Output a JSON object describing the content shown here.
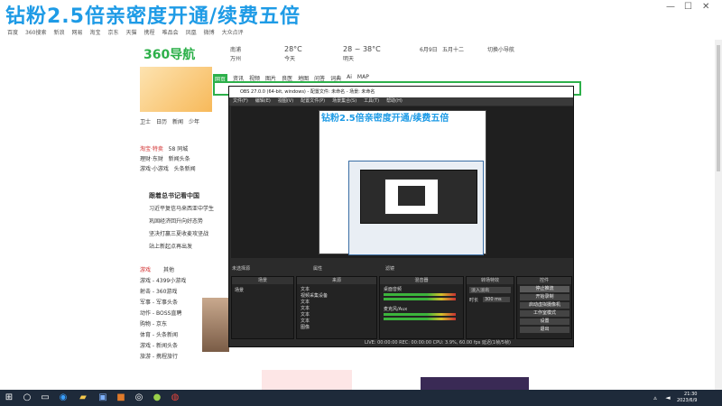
{
  "overlay_text": "钻粉2.5倍亲密度开通/续费五倍",
  "bookmarks": [
    "百度",
    "360搜索",
    "新浪",
    "网易",
    "淘宝",
    "京东",
    "天猫",
    "携程",
    "唯品会",
    "凤凰",
    "微博",
    "大众点评"
  ],
  "logo": "360导航",
  "weather": {
    "city1": "南浦",
    "loc1": "万州",
    "temp1": "28°C",
    "cond1": "今天",
    "temp2": "28 ~ 38°C",
    "cond2": "明天",
    "date": "6月9日",
    "lunar": "五月十二",
    "extra": "切换小导航"
  },
  "search_tabs": [
    "网页",
    "资讯",
    "视频",
    "图片",
    "良医",
    "地图",
    "问答",
    "词典",
    "Ai",
    "MAP"
  ],
  "left_nav": [
    "卫士",
    "日历",
    "新闻",
    "少年"
  ],
  "left_list": [
    "淘宝·特卖",
    "理财·东财",
    "游戏·小游戏"
  ],
  "left_list2": [
    "58 同城",
    "新闻头条",
    "头条新闻"
  ],
  "news_headline": "跟着总书记看中国",
  "news_lines": [
    "习近平复信马来西亚中学生",
    "巩固经济回升向好态势",
    "坚决打赢三夏收麦攻坚战",
    "站上新起点再出发"
  ],
  "left_lower_tabs": [
    "游戏",
    "其他"
  ],
  "left_lower": [
    "游戏 - 4399小游戏",
    "射击 - 360游戏",
    "军事 - 军事头条",
    "动作 - BOSS直聘",
    "购物 - 京东",
    "体育 - 头条新闻",
    "游戏 - 新闻头条",
    "旅游 - 携程旅行"
  ],
  "obs": {
    "title": "OBS 27.0.0 (64-bit, windows) - 配置文件: 未命名 - 场景: 未命名",
    "menu": [
      "文件(F)",
      "编辑(E)",
      "视图(V)",
      "配置文件(P)",
      "场景集合(S)",
      "工具(T)",
      "帮助(H)"
    ],
    "no_source": "未选择源",
    "properties": "属性",
    "filters": "滤镜",
    "docks": {
      "scenes": "场景",
      "sources": "来源",
      "mixer": "混音器",
      "transitions": "转场特效",
      "controls": "控件"
    },
    "scene_item": "场景",
    "sources_list": [
      "文本",
      "视频采集设备",
      "文本",
      "文本",
      "文本",
      "文本",
      "图像"
    ],
    "mixer_tracks": [
      "桌面音频",
      "麦克风/Aux"
    ],
    "transition_type": "淡入淡出",
    "duration_label": "时长",
    "duration_value": "300 ms",
    "controls": [
      "停止推流",
      "开始录制",
      "启动虚拟摄像机",
      "工作室模式",
      "设置",
      "退出"
    ],
    "status": "LIVE: 00:00:00   REC: 00:00:00   CPU: 3.9%, 60.00 fps   延迟(1帧/5帧)"
  },
  "clock": {
    "time": "21:30",
    "date": "2023/6/9"
  }
}
